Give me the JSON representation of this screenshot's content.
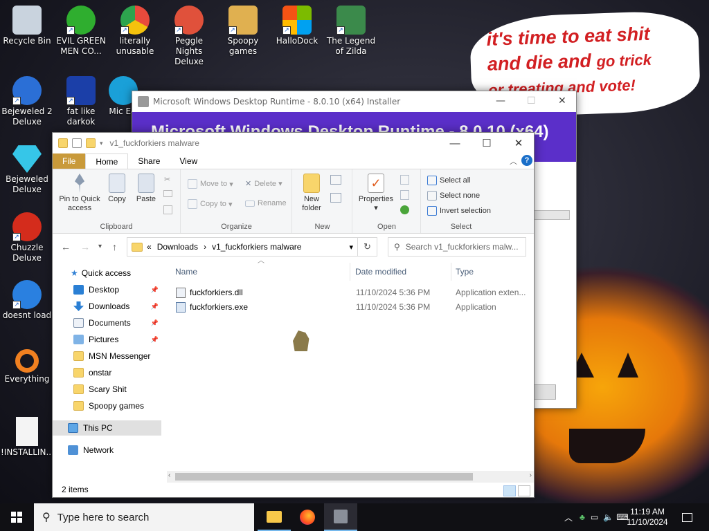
{
  "desktop": {
    "icons": [
      {
        "label": "Recycle Bin",
        "color": "#c9d3de"
      },
      {
        "label": "EVIL GREEN MEN CO...",
        "color": "#2fae2f"
      },
      {
        "label": "literally unusable",
        "color": "#e84a3c"
      },
      {
        "label": "Peggle Nights Deluxe",
        "color": "#e0513b"
      },
      {
        "label": "Spoopy games",
        "color": "#e0b050"
      },
      {
        "label": "HalloDock",
        "color": "#2a7fd4"
      },
      {
        "label": "The Legend of Zilda",
        "color": "#3b8a4b"
      },
      {
        "label": "Bejeweled 2 Deluxe",
        "color": "#2b6fd6"
      },
      {
        "label": "fat like darkok",
        "color": "#1b3fa8"
      },
      {
        "label": "Mic Ed",
        "color": "#1aa0d8"
      },
      {
        "label": "Bejeweled Deluxe",
        "color": "#36c6e8"
      },
      {
        "label": "Chuzzle Deluxe",
        "color": "#d42c1c"
      },
      {
        "label": "doesnt load",
        "color": "#2a80e0"
      },
      {
        "label": "Everything",
        "color": "#f08020"
      },
      {
        "label": "!INSTALLIN...",
        "color": "#f4f4f4"
      }
    ],
    "bubble_line1": "it's time to eat shit",
    "bubble_line2a": "and die and",
    "bubble_line2b": "go trick",
    "bubble_line3": "or treating and vote!"
  },
  "installer": {
    "title": "Microsoft Windows Desktop Runtime - 8.0.10 (x64) Installer",
    "heading": "Microsoft Windows Desktop Runtime - 8.0.10 (x64)",
    "accent": "#5b2fc9"
  },
  "explorer": {
    "title": "v1_fuckforkiers malware",
    "tabs": {
      "file": "File",
      "home": "Home",
      "share": "Share",
      "view": "View"
    },
    "ribbon": {
      "pin": "Pin to Quick access",
      "copy": "Copy",
      "paste": "Paste",
      "clipboard": "Clipboard",
      "move_to": "Move to",
      "copy_to": "Copy to",
      "delete": "Delete",
      "rename": "Rename",
      "organize": "Organize",
      "new_folder": "New folder",
      "new": "New",
      "properties": "Properties",
      "open": "Open",
      "select_all": "Select all",
      "select_none": "Select none",
      "invert": "Invert selection",
      "select": "Select"
    },
    "address": {
      "prefix": "«",
      "crumb1": "Downloads",
      "crumb2": "v1_fuckforkiers malware"
    },
    "search_placeholder": "Search v1_fuckforkiers malw...",
    "nav": {
      "quick_access": "Quick access",
      "items": [
        "Desktop",
        "Downloads",
        "Documents",
        "Pictures",
        "MSN Messenger",
        "onstar",
        "Scary Shit",
        "Spoopy games"
      ],
      "this_pc": "This PC",
      "network": "Network"
    },
    "columns": {
      "name": "Name",
      "date": "Date modified",
      "type": "Type"
    },
    "files": [
      {
        "name": "fuckforkiers.dll",
        "date": "11/10/2024 5:36 PM",
        "type": "Application exten..."
      },
      {
        "name": "fuckforkiers.exe",
        "date": "11/10/2024 5:36 PM",
        "type": "Application"
      }
    ],
    "status": "2 items"
  },
  "taskbar": {
    "search_placeholder": "Type here to search",
    "time": "11:19 AM",
    "date": "11/10/2024"
  }
}
